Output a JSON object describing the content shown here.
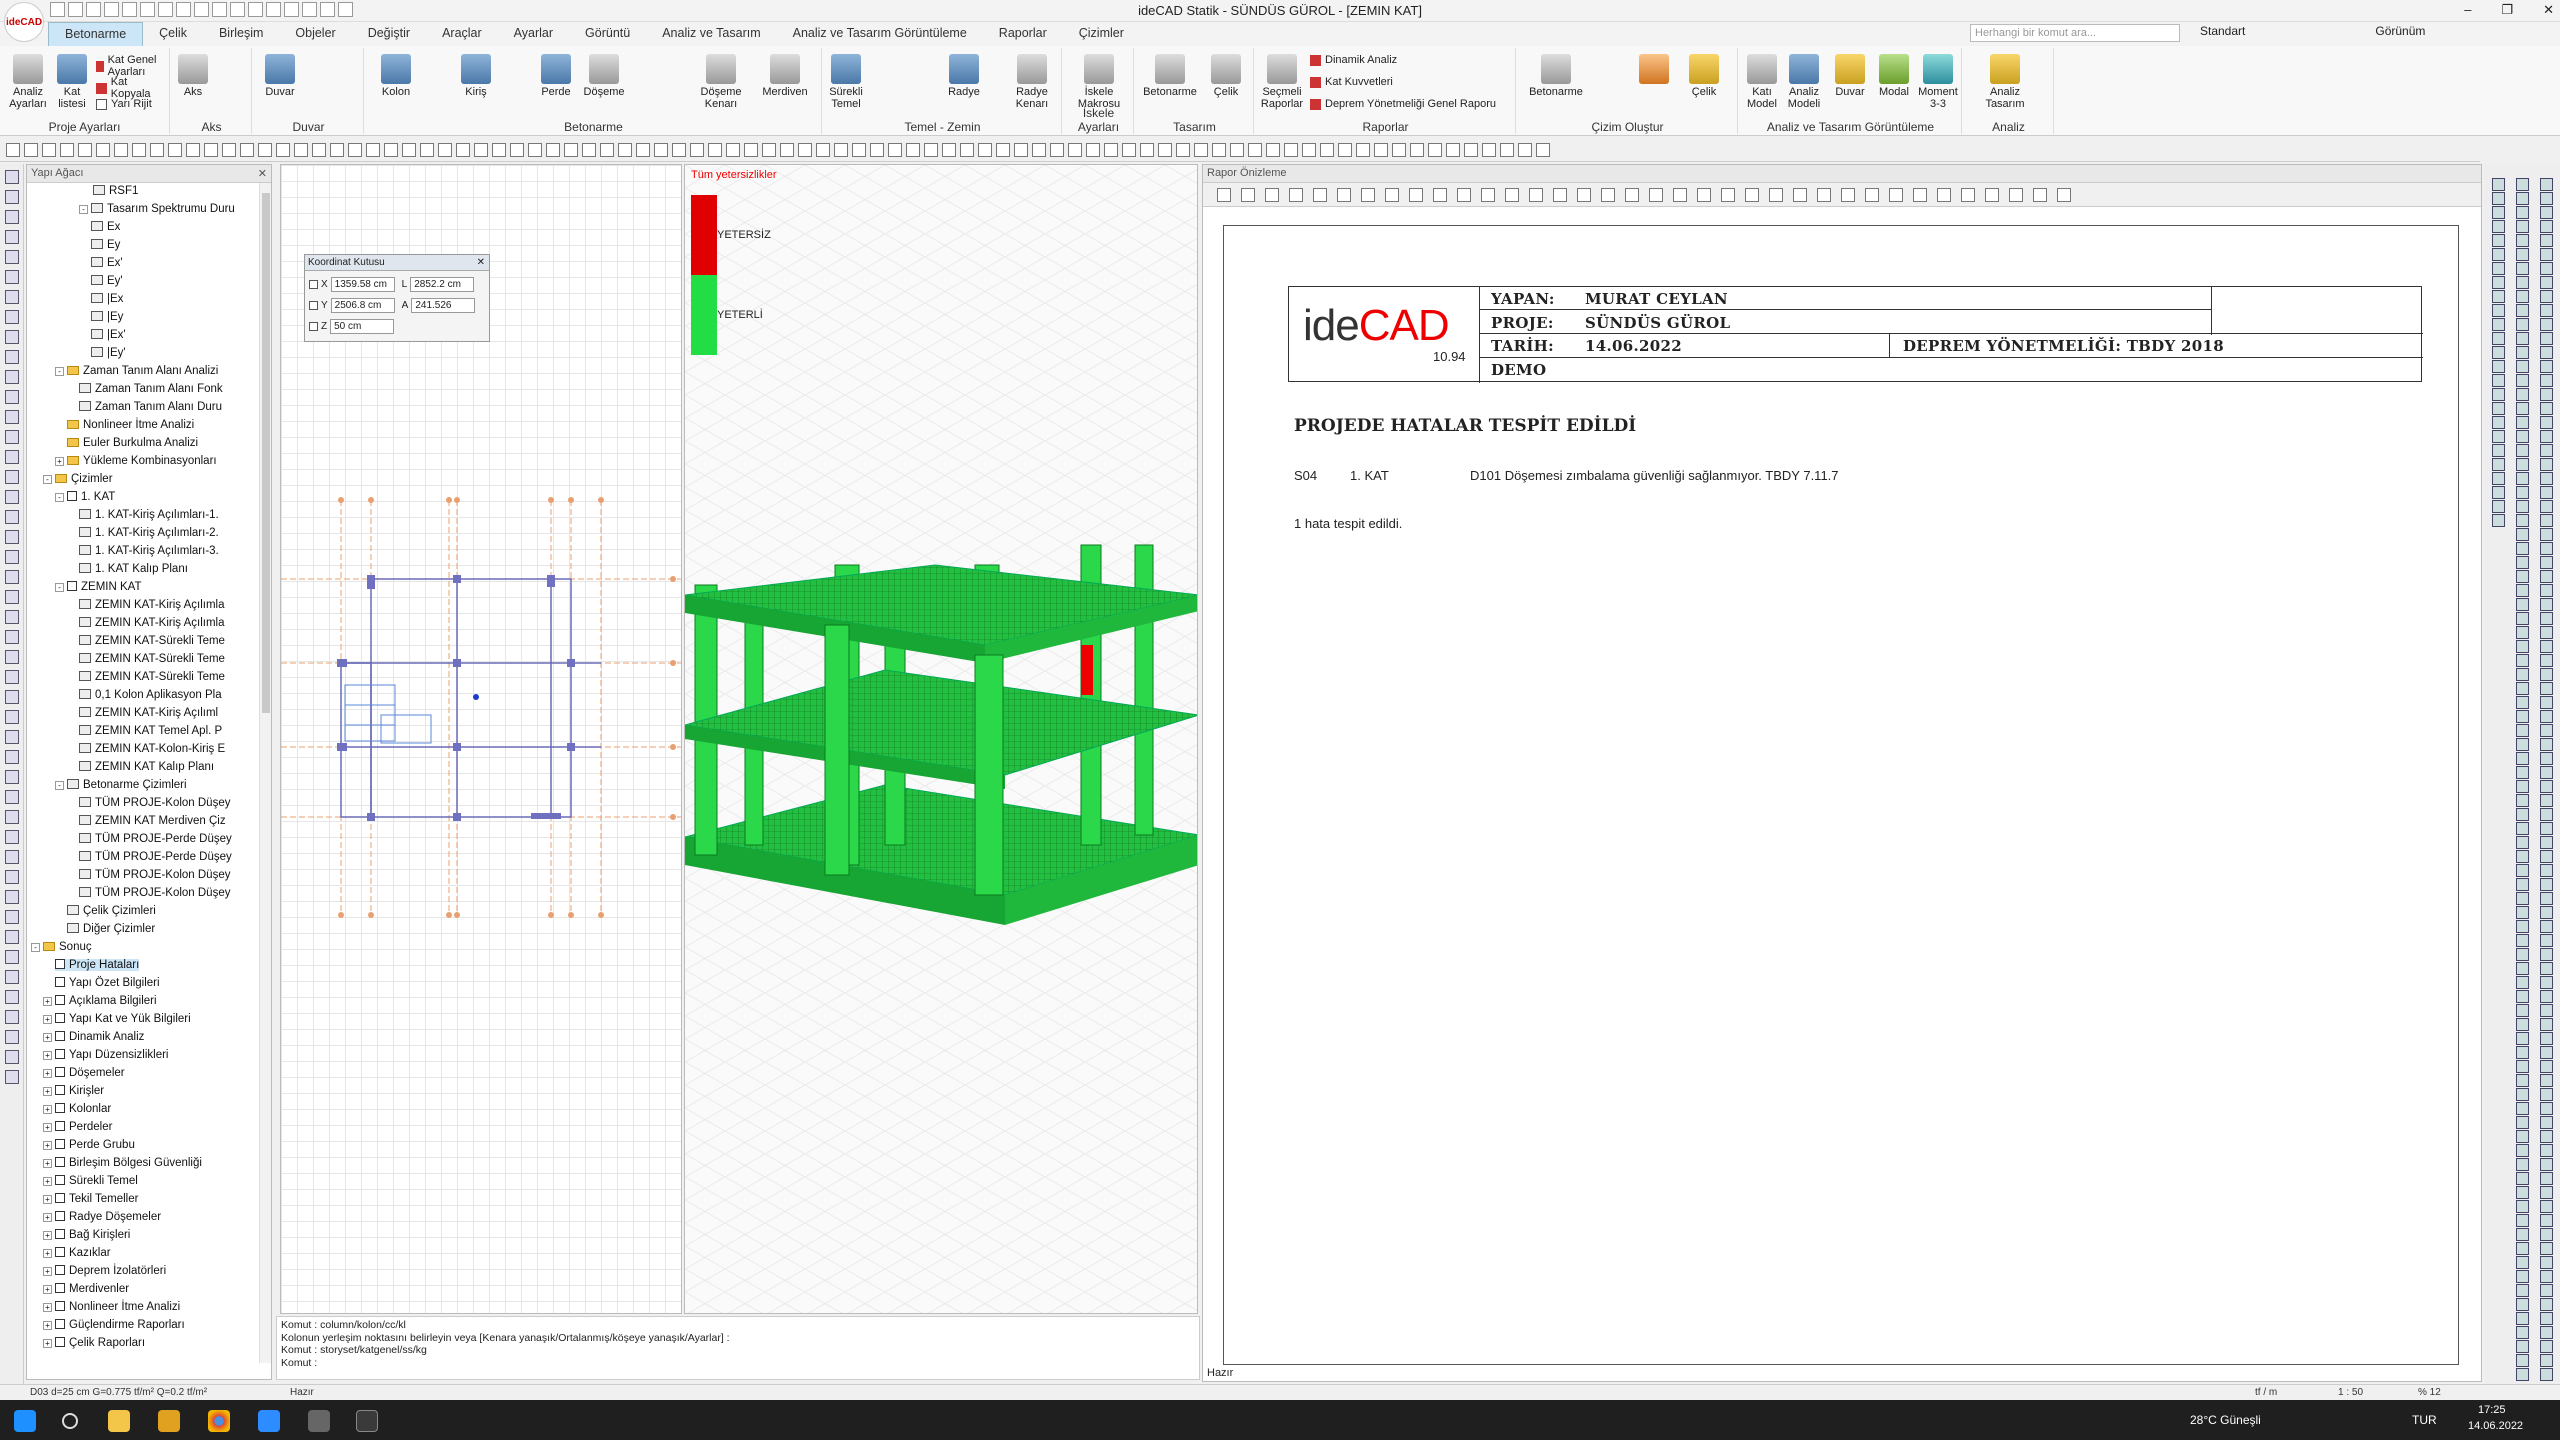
{
  "window": {
    "title": "ideCAD Statik - SÜNDÜS GÜROL - [ZEMIN KAT]",
    "logo": "ideCAD"
  },
  "tabs": [
    "Betonarme",
    "Çelik",
    "Birleşim",
    "Objeler",
    "Değiştir",
    "Araçlar",
    "Ayarlar",
    "Görüntü",
    "Analiz ve Tasarım",
    "Analiz ve Tasarım Görüntüleme",
    "Raporlar",
    "Çizimler"
  ],
  "search": {
    "placeholder": "Herhangi bir komut ara..."
  },
  "right_controls": {
    "style": "Standart",
    "view": "Görünüm"
  },
  "ribbon": {
    "proje": {
      "label": "Proje Ayarları",
      "b1": "Analiz Ayarları",
      "b2": "Kat listesi",
      "s1": "Kat Genel Ayarları",
      "s2": "Kat Kopyala",
      "s3": "Yarı Rijit"
    },
    "aks": {
      "label": "Aks",
      "b1": "Aks"
    },
    "duvar": {
      "label": "Duvar",
      "b1": "Duvar"
    },
    "betonarme": {
      "label": "Betonarme",
      "b1": "Kolon",
      "b2": "Kiriş",
      "b3": "Perde",
      "b4": "Döşeme",
      "b5": "Döşeme Kenarı",
      "b6": "Merdiven"
    },
    "temel": {
      "label": "Temel - Zemin",
      "b1": "Sürekli Temel",
      "b2": "Radye",
      "b3": "Radye Kenarı"
    },
    "iskele": {
      "label": "İskele Ayarları",
      "b1": "İskele Makrosu"
    },
    "tasarim": {
      "label": "Tasarım",
      "b1": "Betonarme",
      "b2": "Çelik"
    },
    "raporlar": {
      "label": "Raporlar",
      "b1": "Seçmeli Raporlar",
      "s1": "Dinamik Analiz",
      "s2": "Kat Kuvvetleri",
      "s3": "Deprem Yönetmeliği Genel Raporu"
    },
    "cizim": {
      "label": "Çizim Oluştur",
      "b1": "Betonarme",
      "b2": "Çelik"
    },
    "goruntuleme": {
      "label": "Analiz ve Tasarım Görüntüleme",
      "b1": "Katı Model",
      "b2": "Analiz Modeli",
      "b3": "Duvar",
      "b4": "Modal",
      "b5": "Moment 3-3"
    },
    "analiz": {
      "label": "Analiz",
      "b1": "Analiz Tasarım"
    }
  },
  "tree": {
    "title": "Yapı Ağacı",
    "items": [
      {
        "t": "RSF1",
        "x": 64,
        "k": "ic"
      },
      {
        "t": "Tasarım Spektrumu Duru",
        "x": 50,
        "k": "ic",
        "p": "-"
      },
      {
        "t": "Ex",
        "x": 62,
        "k": "ic"
      },
      {
        "t": "Ey",
        "x": 62,
        "k": "ic"
      },
      {
        "t": "Ex'",
        "x": 62,
        "k": "ic"
      },
      {
        "t": "Ey'",
        "x": 62,
        "k": "ic"
      },
      {
        "t": "|Ex",
        "x": 62,
        "k": "ic"
      },
      {
        "t": "|Ey",
        "x": 62,
        "k": "ic"
      },
      {
        "t": "|Ex'",
        "x": 62,
        "k": "ic"
      },
      {
        "t": "|Ey'",
        "x": 62,
        "k": "ic"
      },
      {
        "t": "Zaman Tanım Alanı Analizi",
        "x": 26,
        "k": "f",
        "p": "-"
      },
      {
        "t": "Zaman Tanım Alanı Fonk",
        "x": 50,
        "k": "ic"
      },
      {
        "t": "Zaman Tanım Alanı Duru",
        "x": 50,
        "k": "ic"
      },
      {
        "t": "Nonlineer İtme Analizi",
        "x": 38,
        "k": "f"
      },
      {
        "t": "Euler Burkulma Analizi",
        "x": 38,
        "k": "f"
      },
      {
        "t": "Yükleme Kombinasyonları",
        "x": 26,
        "k": "f",
        "p": "+"
      },
      {
        "t": "Çizimler",
        "x": 14,
        "k": "f",
        "p": "-"
      },
      {
        "t": "1. KAT",
        "x": 26,
        "k": "b",
        "p": "-"
      },
      {
        "t": "1. KAT-Kiriş Açılımları-1.",
        "x": 50,
        "k": "ic"
      },
      {
        "t": "1. KAT-Kiriş Açılımları-2.",
        "x": 50,
        "k": "ic"
      },
      {
        "t": "1. KAT-Kiriş Açılımları-3.",
        "x": 50,
        "k": "ic"
      },
      {
        "t": "1. KAT Kalıp Planı",
        "x": 50,
        "k": "ic"
      },
      {
        "t": "ZEMIN KAT",
        "x": 26,
        "k": "b",
        "p": "-"
      },
      {
        "t": "ZEMIN KAT-Kiriş Açılımla",
        "x": 50,
        "k": "ic"
      },
      {
        "t": "ZEMIN KAT-Kiriş Açılımla",
        "x": 50,
        "k": "ic"
      },
      {
        "t": "ZEMIN KAT-Sürekli Teme",
        "x": 50,
        "k": "ic"
      },
      {
        "t": "ZEMIN KAT-Sürekli Teme",
        "x": 50,
        "k": "ic"
      },
      {
        "t": "ZEMIN KAT-Sürekli Teme",
        "x": 50,
        "k": "ic"
      },
      {
        "t": "0,1 Kolon Aplikasyon Pla",
        "x": 50,
        "k": "ic"
      },
      {
        "t": "ZEMIN KAT-Kiriş Açılıml",
        "x": 50,
        "k": "ic"
      },
      {
        "t": "ZEMIN KAT Temel Apl. P",
        "x": 50,
        "k": "ic"
      },
      {
        "t": "ZEMIN KAT-Kolon-Kiriş E",
        "x": 50,
        "k": "ic"
      },
      {
        "t": "ZEMIN KAT Kalıp Planı",
        "x": 50,
        "k": "ic"
      },
      {
        "t": "Betonarme Çizimleri",
        "x": 26,
        "k": "ic",
        "p": "-"
      },
      {
        "t": "TÜM PROJE-Kolon Düşey",
        "x": 50,
        "k": "ic"
      },
      {
        "t": "ZEMIN KAT Merdiven Çiz",
        "x": 50,
        "k": "ic"
      },
      {
        "t": "TÜM PROJE-Perde Düşey",
        "x": 50,
        "k": "ic"
      },
      {
        "t": "TÜM PROJE-Perde Düşey",
        "x": 50,
        "k": "ic"
      },
      {
        "t": "TÜM PROJE-Kolon Düşey",
        "x": 50,
        "k": "ic"
      },
      {
        "t": "TÜM PROJE-Kolon Düşey",
        "x": 50,
        "k": "ic"
      },
      {
        "t": "Çelik Çizimleri",
        "x": 38,
        "k": "ic"
      },
      {
        "t": "Diğer Çizimler",
        "x": 38,
        "k": "ic"
      },
      {
        "t": "Sonuç",
        "x": 2,
        "k": "f",
        "p": "-"
      },
      {
        "t": "Proje Hataları",
        "x": 26,
        "k": "b",
        "sel": true
      },
      {
        "t": "Yapı Özet Bilgileri",
        "x": 26,
        "k": "b"
      },
      {
        "t": "Açıklama Bilgileri",
        "x": 14,
        "k": "b",
        "p": "+"
      },
      {
        "t": "Yapı Kat ve Yük Bilgileri",
        "x": 14,
        "k": "b",
        "p": "+"
      },
      {
        "t": "Dinamik Analiz",
        "x": 14,
        "k": "b",
        "p": "+"
      },
      {
        "t": "Yapı Düzensizlikleri",
        "x": 14,
        "k": "b",
        "p": "+"
      },
      {
        "t": "Döşemeler",
        "x": 14,
        "k": "b",
        "p": "+"
      },
      {
        "t": "Kirişler",
        "x": 14,
        "k": "b",
        "p": "+"
      },
      {
        "t": "Kolonlar",
        "x": 14,
        "k": "b",
        "p": "+"
      },
      {
        "t": "Perdeler",
        "x": 14,
        "k": "b",
        "p": "+"
      },
      {
        "t": "Perde Grubu",
        "x": 14,
        "k": "b",
        "p": "+"
      },
      {
        "t": "Birleşim Bölgesi Güvenliği",
        "x": 14,
        "k": "b",
        "p": "+"
      },
      {
        "t": "Sürekli Temel",
        "x": 14,
        "k": "b",
        "p": "+"
      },
      {
        "t": "Tekil Temeller",
        "x": 14,
        "k": "b",
        "p": "+"
      },
      {
        "t": "Radye Döşemeler",
        "x": 14,
        "k": "b",
        "p": "+"
      },
      {
        "t": "Bağ Kirişleri",
        "x": 14,
        "k": "b",
        "p": "+"
      },
      {
        "t": "Kazıklar",
        "x": 14,
        "k": "b",
        "p": "+"
      },
      {
        "t": "Deprem İzolatörleri",
        "x": 14,
        "k": "b",
        "p": "+"
      },
      {
        "t": "Merdivenler",
        "x": 14,
        "k": "b",
        "p": "+"
      },
      {
        "t": "Nonlineer İtme Analizi",
        "x": 14,
        "k": "b",
        "p": "+"
      },
      {
        "t": "Güçlendirme Raporları",
        "x": 14,
        "k": "b",
        "p": "+"
      },
      {
        "t": "Çelik Raporları",
        "x": 14,
        "k": "b",
        "p": "+"
      }
    ]
  },
  "coord_box": {
    "title": "Koordinat Kutusu",
    "x": "1359.58 cm",
    "y": "2506.8 cm",
    "z": "50 cm",
    "l_label": "L",
    "l": "2852.2 cm",
    "a_label": "A",
    "a": "241.526",
    "xl": "X",
    "yl": "Y",
    "zl": "Z"
  },
  "view3d": {
    "legend_title": "Tüm yetersizlikler",
    "l1": "YETERSİZ",
    "l2": "YETERLİ",
    "c_bad": "#e00000",
    "c_good": "#22dd44"
  },
  "command": {
    "l1": "Komut : column/kolon/cc/kl",
    "l2": "Kolonun yerleşim noktasını belirleyin veya [Kenara yanaşık/Ortalanmış/köşeye yanaşık/Ayarlar] :",
    "l3": "Komut : storyset/katgenel/ss/kg",
    "l4": "Komut :"
  },
  "report": {
    "panel_title": "Rapor Önizleme",
    "brand": "ideCAD",
    "version": "10.94",
    "yapan_label": "YAPAN:",
    "yapan": "MURAT CEYLAN",
    "proje_label": "PROJE:",
    "proje": "SÜNDÜS GÜROL",
    "tarih_label": "TARİH:",
    "tarih": "14.06.2022",
    "yonetmelik": "DEPREM YÖNETMELİĞİ: TBDY 2018",
    "demo": "DEMO",
    "heading": "PROJEDE HATALAR TESPİT EDİLDİ",
    "err_code": "S04",
    "err_floor": "1. KAT",
    "err_text": "D101 Döşemesi zımbalama güvenliği sağlanmıyor. TBDY 7.11.7",
    "summary": "1 hata tespit edildi.",
    "status": "Hazır"
  },
  "statusbar": {
    "left": "D03 d=25 cm G=0.775 tf/m² Q=0.2 tf/m²",
    "ready": "Hazır",
    "unit": "tf / m",
    "scale": "1 : 50",
    "zoom": "% 12"
  },
  "taskbar": {
    "weather": "28°C Güneşli",
    "lang": "TUR",
    "time": "17:25",
    "date": "14.06.2022"
  }
}
